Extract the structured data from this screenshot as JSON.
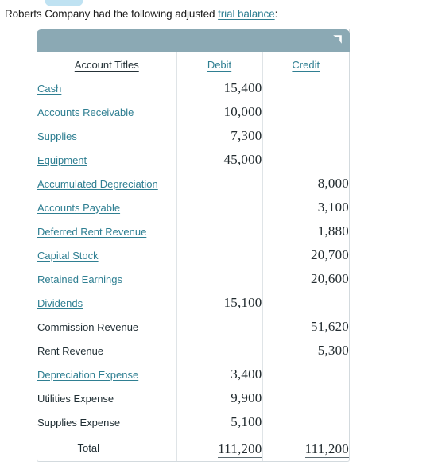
{
  "intro": {
    "text_before": "Roberts Company had the following adjusted ",
    "link_text": "trial balance",
    "text_after": ":"
  },
  "table": {
    "titlebar_icon": "corner-flag-icon",
    "colors": {
      "titlebar": "#8ba9b4",
      "link": "#2f7f92",
      "text": "#1f2d33",
      "border": "#d3dade"
    },
    "columns": [
      {
        "label": "Account Titles",
        "is_link": false
      },
      {
        "label": "Debit",
        "is_link": true
      },
      {
        "label": "Credit",
        "is_link": true
      }
    ],
    "rows": [
      {
        "title": "Cash",
        "is_link": true,
        "debit": "15,400",
        "credit": ""
      },
      {
        "title": "Accounts Receivable",
        "is_link": true,
        "debit": "10,000",
        "credit": ""
      },
      {
        "title": "Supplies",
        "is_link": true,
        "debit": "7,300",
        "credit": ""
      },
      {
        "title": "Equipment",
        "is_link": true,
        "debit": "45,000",
        "credit": ""
      },
      {
        "title": "Accumulated Depreciation",
        "is_link": true,
        "debit": "",
        "credit": "8,000"
      },
      {
        "title": "Accounts Payable",
        "is_link": true,
        "debit": "",
        "credit": "3,100"
      },
      {
        "title": "Deferred Rent Revenue",
        "is_link": true,
        "debit": "",
        "credit": "1,880"
      },
      {
        "title": "Capital Stock",
        "is_link": true,
        "debit": "",
        "credit": "20,700"
      },
      {
        "title": "Retained Earnings",
        "is_link": true,
        "debit": "",
        "credit": "20,600"
      },
      {
        "title": "Dividends",
        "is_link": true,
        "debit": "15,100",
        "credit": ""
      },
      {
        "title": "Commission Revenue",
        "is_link": false,
        "debit": "",
        "credit": "51,620"
      },
      {
        "title": "Rent Revenue",
        "is_link": false,
        "debit": "",
        "credit": "5,300"
      },
      {
        "title": "Depreciation Expense",
        "is_link": true,
        "debit": "3,400",
        "credit": ""
      },
      {
        "title": "Utilities Expense",
        "is_link": false,
        "debit": "9,900",
        "credit": ""
      },
      {
        "title": "Supplies Expense",
        "is_link": false,
        "debit": "5,100",
        "credit": ""
      }
    ],
    "total": {
      "label": "Total",
      "debit": "111,200",
      "credit": "111,200"
    }
  }
}
